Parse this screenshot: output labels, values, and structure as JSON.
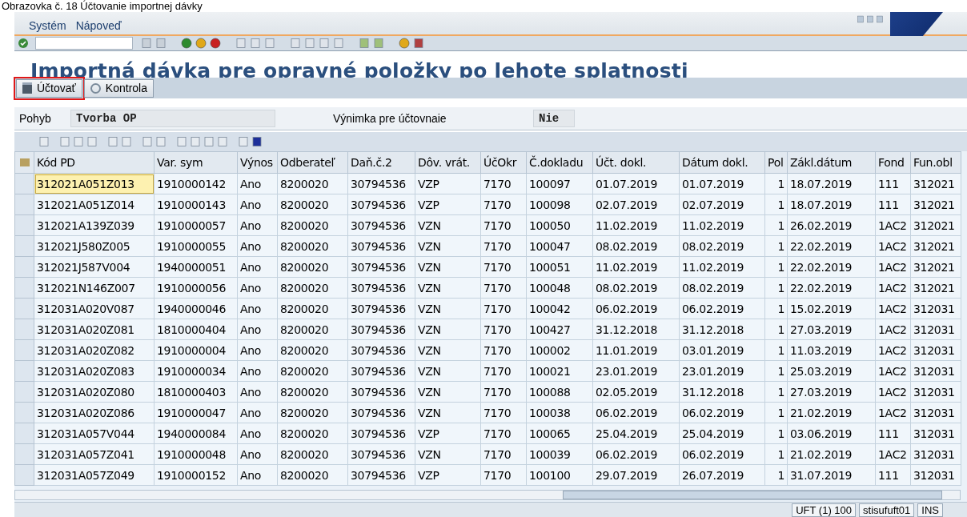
{
  "caption": "Obrazovka č. 18 Účtovanie importnej dávky",
  "menu": [
    {
      "label": "Systém"
    },
    {
      "label": "Nápoveď"
    }
  ],
  "title": "Importná dávka pre opravné položky po lehote splatnosti",
  "buttons": [
    {
      "label": "Účtovať",
      "kind": "post",
      "annotated": true
    },
    {
      "label": "Kontrola",
      "kind": "check",
      "annotated": false
    }
  ],
  "fields": [
    {
      "label": "Pohyb",
      "value": "Tvorba OP"
    },
    {
      "label": "Výnimka pre účtovnaie",
      "value": "Nie"
    }
  ],
  "table": {
    "columns": [
      "Kód PD",
      "Var. sym",
      "Výnos",
      "Odberateľ",
      "Daň.č.2",
      "Dôv. vrát.",
      "ÚčOkr",
      "Č.dokladu",
      "Účt. dokl.",
      "Dátum dokl.",
      "Pol",
      "Zákl.dátum",
      "Fond",
      "Fun.obl"
    ],
    "rows": [
      {
        "current": true,
        "cells": [
          "312021A051Z013",
          "1910000142",
          "Ano",
          "8200020",
          "30794536",
          "VZP",
          "7170",
          "100097",
          "01.07.2019",
          "01.07.2019",
          "1",
          "18.07.2019",
          "111",
          "312021"
        ]
      },
      {
        "current": false,
        "cells": [
          "312021A051Z014",
          "1910000143",
          "Ano",
          "8200020",
          "30794536",
          "VZP",
          "7170",
          "100098",
          "02.07.2019",
          "02.07.2019",
          "1",
          "18.07.2019",
          "111",
          "312021"
        ]
      },
      {
        "current": false,
        "cells": [
          "312021A139Z039",
          "1910000057",
          "Ano",
          "8200020",
          "30794536",
          "VZN",
          "7170",
          "100050",
          "11.02.2019",
          "11.02.2019",
          "1",
          "26.02.2019",
          "1AC2",
          "312021"
        ]
      },
      {
        "current": false,
        "cells": [
          "312021J580Z005",
          "1910000055",
          "Ano",
          "8200020",
          "30794536",
          "VZN",
          "7170",
          "100047",
          "08.02.2019",
          "08.02.2019",
          "1",
          "22.02.2019",
          "1AC2",
          "312021"
        ]
      },
      {
        "current": false,
        "cells": [
          "312021J587V004",
          "1940000051",
          "Ano",
          "8200020",
          "30794536",
          "VZN",
          "7170",
          "100051",
          "11.02.2019",
          "11.02.2019",
          "1",
          "22.02.2019",
          "1AC2",
          "312021"
        ]
      },
      {
        "current": false,
        "cells": [
          "312021N146Z007",
          "1910000056",
          "Ano",
          "8200020",
          "30794536",
          "VZN",
          "7170",
          "100048",
          "08.02.2019",
          "08.02.2019",
          "1",
          "22.02.2019",
          "1AC2",
          "312021"
        ]
      },
      {
        "current": false,
        "cells": [
          "312031A020V087",
          "1940000046",
          "Ano",
          "8200020",
          "30794536",
          "VZN",
          "7170",
          "100042",
          "06.02.2019",
          "06.02.2019",
          "1",
          "15.02.2019",
          "1AC2",
          "312031"
        ]
      },
      {
        "current": false,
        "cells": [
          "312031A020Z081",
          "1810000404",
          "Ano",
          "8200020",
          "30794536",
          "VZN",
          "7170",
          "100427",
          "31.12.2018",
          "31.12.2018",
          "1",
          "27.03.2019",
          "1AC2",
          "312031"
        ]
      },
      {
        "current": false,
        "cells": [
          "312031A020Z082",
          "1910000004",
          "Ano",
          "8200020",
          "30794536",
          "VZN",
          "7170",
          "100002",
          "11.01.2019",
          "03.01.2019",
          "1",
          "11.03.2019",
          "1AC2",
          "312031"
        ]
      },
      {
        "current": false,
        "cells": [
          "312031A020Z083",
          "1910000034",
          "Ano",
          "8200020",
          "30794536",
          "VZN",
          "7170",
          "100021",
          "23.01.2019",
          "23.01.2019",
          "1",
          "25.03.2019",
          "1AC2",
          "312031"
        ]
      },
      {
        "current": false,
        "cells": [
          "312031A020Z080",
          "1810000403",
          "Ano",
          "8200020",
          "30794536",
          "VZN",
          "7170",
          "100088",
          "02.05.2019",
          "31.12.2018",
          "1",
          "27.03.2019",
          "1AC2",
          "312031"
        ]
      },
      {
        "current": false,
        "cells": [
          "312031A020Z086",
          "1910000047",
          "Ano",
          "8200020",
          "30794536",
          "VZN",
          "7170",
          "100038",
          "06.02.2019",
          "06.02.2019",
          "1",
          "21.02.2019",
          "1AC2",
          "312031"
        ]
      },
      {
        "current": false,
        "cells": [
          "312031A057V044",
          "1940000084",
          "Ano",
          "8200020",
          "30794536",
          "VZP",
          "7170",
          "100065",
          "25.04.2019",
          "25.04.2019",
          "1",
          "03.06.2019",
          "111",
          "312031"
        ]
      },
      {
        "current": false,
        "cells": [
          "312031A057Z041",
          "1910000048",
          "Ano",
          "8200020",
          "30794536",
          "VZN",
          "7170",
          "100039",
          "06.02.2019",
          "06.02.2019",
          "1",
          "21.02.2019",
          "1AC2",
          "312031"
        ]
      },
      {
        "current": false,
        "cells": [
          "312031A057Z049",
          "1910000152",
          "Ano",
          "8200020",
          "30794536",
          "VZP",
          "7170",
          "100100",
          "29.07.2019",
          "26.07.2019",
          "1",
          "31.07.2019",
          "111",
          "312031"
        ]
      }
    ]
  },
  "status_bar": [
    "UFT (1) 100",
    "stisufuft01",
    "INS"
  ]
}
